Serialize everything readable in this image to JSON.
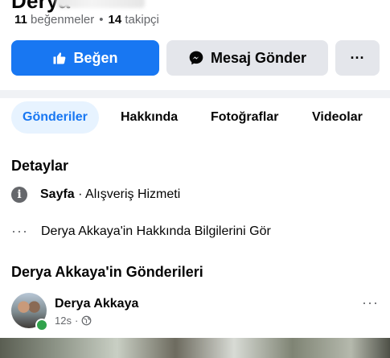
{
  "profile": {
    "name_partial": "Derya",
    "likes_count": "11",
    "likes_label": "beğenmeler",
    "separator": "•",
    "followers_count": "14",
    "followers_label": "takipçi"
  },
  "actions": {
    "like_label": "Beğen",
    "message_label": "Mesaj Gönder",
    "more_label": "···"
  },
  "tabs": [
    {
      "label": "Gönderiler",
      "active": true
    },
    {
      "label": "Hakkında"
    },
    {
      "label": "Fotoğraflar"
    },
    {
      "label": "Videolar"
    }
  ],
  "details": {
    "heading": "Detaylar",
    "page_type_bold": "Sayfa",
    "page_type_rest": " · Alışveriş Hizmeti",
    "about_link": "Derya Akkaya'in Hakkında Bilgilerini Gör"
  },
  "posts": {
    "heading": "Derya Akkaya'in Gönderileri",
    "items": [
      {
        "author": "Derya Akkaya",
        "time": "12s",
        "privacy_icon": "globe-icon"
      }
    ]
  },
  "colors": {
    "accent": "#1877f2",
    "button_gray": "#e4e6eb",
    "secondary_text": "#65676b",
    "online": "#31a24c"
  }
}
